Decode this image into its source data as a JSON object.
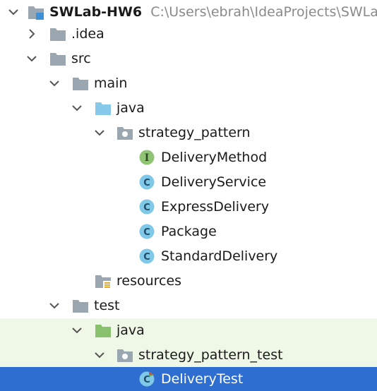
{
  "project": {
    "name": "SWLab-HW6",
    "path": "C:\\Users\\ebrah\\IdeaProjects\\SWLab"
  },
  "nodes": {
    "idea": ".idea",
    "src": "src",
    "main": "main",
    "main_java": "java",
    "strategy_pattern": "strategy_pattern",
    "delivery_method": "DeliveryMethod",
    "delivery_service": "DeliveryService",
    "express_delivery": "ExpressDelivery",
    "package": "Package",
    "standard_delivery": "StandardDelivery",
    "resources": "resources",
    "test": "test",
    "test_java": "java",
    "strategy_pattern_test": "strategy_pattern_test",
    "delivery_test": "DeliveryTest"
  },
  "icon_letters": {
    "interface": "I",
    "class": "C"
  },
  "colors": {
    "selection": "#2e6ed0",
    "test_background": "#eff7e6",
    "folder": "#9aa7b0",
    "source_folder": "#86c9ea",
    "test_source_folder": "#88c16b",
    "class_icon": "#7fc8e8",
    "interface_icon": "#8fc474",
    "path_text": "#8a8a8a"
  },
  "icons": [
    "module-icon",
    "folder-icon",
    "source-root-icon",
    "test-root-icon",
    "package-icon",
    "resources-icon",
    "class-icon",
    "interface-icon",
    "test-class-icon",
    "chevron-right-icon",
    "chevron-down-icon"
  ]
}
